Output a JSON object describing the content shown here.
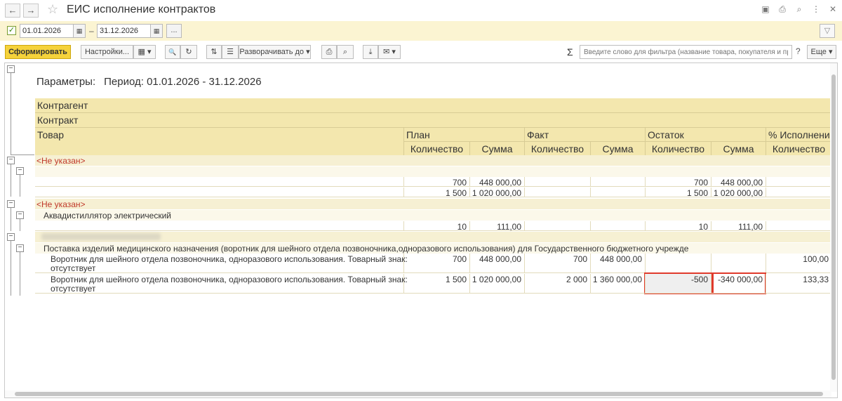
{
  "window": {
    "title": "ЕИС исполнение контрактов",
    "back_icon": "←",
    "forward_icon": "→",
    "favorite_icon": "☆",
    "right_icons": [
      "save-icon",
      "print-icon",
      "preview-icon",
      "more-icon",
      "close-icon"
    ],
    "right_glyphs": [
      "▣",
      "⎙",
      "⌕",
      "⋮",
      "✕"
    ]
  },
  "period": {
    "enabled_glyph": "✓",
    "date_from": "01.01.2026",
    "separator": "–",
    "date_to": "31.12.2026",
    "calendar_glyph": "▦",
    "more_glyph": "...",
    "filter_glyph": "▽"
  },
  "toolbar": {
    "generate": "Сформировать",
    "settings": "Настройки...",
    "variant_glyph": "▦ ▾",
    "find_glyph": "🔍",
    "find_next_glyph": "↻",
    "sort_glyph": "⇅",
    "group_glyph": "☰",
    "expand": "Разворачивать до ▾",
    "print_glyph": "⎙",
    "preview_glyph": "⌕",
    "download_glyph": "⤓",
    "mail_glyph": "✉ ▾",
    "sum_glyph": "Σ",
    "search_placeholder": "Введите слово для фильтра (название товара, покупателя и пр.)",
    "help": "?",
    "more": "Еще ▾"
  },
  "report": {
    "params_label": "Параметры:",
    "params_value": "Период: 01.01.2026 - 31.12.2026",
    "header": {
      "counterparty": "Контрагент",
      "contract": "Контракт",
      "product": "Товар",
      "plan": "План",
      "fact": "Факт",
      "rest": "Остаток",
      "percent": "% Исполнени",
      "qty": "Количество",
      "sum": "Сумма"
    },
    "groups": [
      {
        "name": "<Не указан>",
        "rows": [
          {
            "plan_qty": "700",
            "plan_sum": "448 000,00",
            "fact_qty": "",
            "fact_sum": "",
            "rest_qty": "700",
            "rest_sum": "448 000,00",
            "pct": ""
          },
          {
            "plan_qty": "1 500",
            "plan_sum": "1 020 000,00",
            "fact_qty": "",
            "fact_sum": "",
            "rest_qty": "1 500",
            "rest_sum": "1 020 000,00",
            "pct": ""
          }
        ]
      },
      {
        "name": "<Не указан>",
        "contract": "Аквадистиллятор электрический",
        "rows": [
          {
            "plan_qty": "10",
            "plan_sum": "111,00",
            "fact_qty": "",
            "fact_sum": "",
            "rest_qty": "10",
            "rest_sum": "111,00",
            "pct": ""
          }
        ]
      },
      {
        "contract": "Поставка изделий медицинского назначения (воротник для шейного отдела позвоночника,одноразового использования) для Государственного бюджетного учрежде",
        "rows": [
          {
            "line1": "Воротник для шейного отдела позвоночника, одноразового использования. Товарный знак:",
            "line2": "отсутствует",
            "plan_qty": "700",
            "plan_sum": "448 000,00",
            "fact_qty": "700",
            "fact_sum": "448 000,00",
            "rest_qty": "",
            "rest_sum": "",
            "pct": "100,00"
          },
          {
            "line1": "Воротник для шейного отдела позвоночника, одноразового использования. Товарный знак:",
            "line2": "отсутствует",
            "plan_qty": "1 500",
            "plan_sum": "1 020 000,00",
            "fact_qty": "2 000",
            "fact_sum": "1 360 000,00",
            "rest_qty": "-500",
            "rest_sum": "-340 000,00",
            "pct": "133,33"
          }
        ]
      }
    ]
  },
  "colors": {
    "param_band": "#fbf4d2",
    "header_bg": "#f3e7ae",
    "group_bg": "#f6f0d3",
    "primary_button": "#f5d23b",
    "red_text": "#c0392b",
    "highlight_border": "#e03a2c"
  }
}
